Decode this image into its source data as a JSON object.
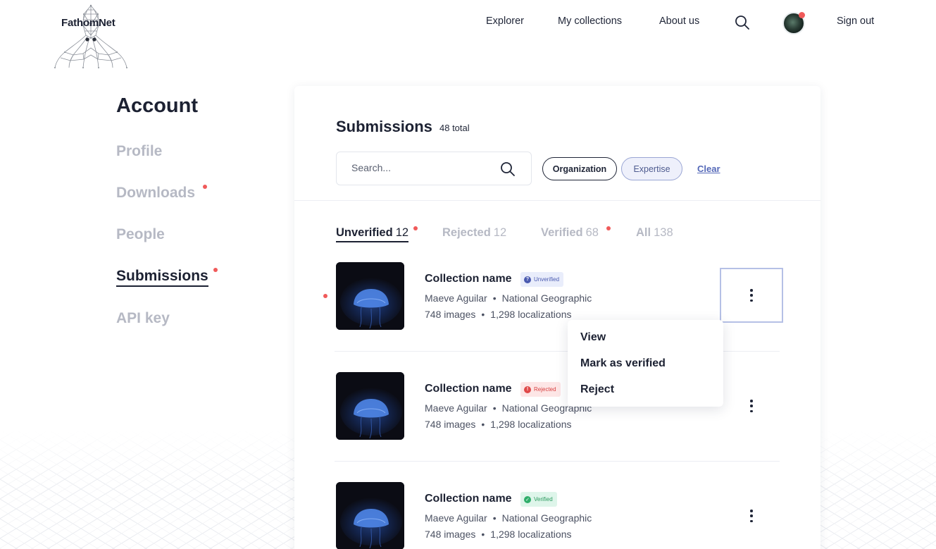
{
  "header": {
    "logo_text": "FathomNet",
    "nav": {
      "explorer": "Explorer",
      "my_collections": "My collections",
      "about": "About us",
      "sign_out": "Sign out"
    }
  },
  "sidebar": {
    "title": "Account",
    "items": [
      {
        "label": "Profile",
        "active": false,
        "has_dot": false
      },
      {
        "label": "Downloads",
        "active": false,
        "has_dot": true
      },
      {
        "label": "People",
        "active": false,
        "has_dot": false
      },
      {
        "label": "Submissions",
        "active": true,
        "has_dot": true
      },
      {
        "label": "API key",
        "active": false,
        "has_dot": false
      }
    ]
  },
  "main": {
    "title": "Submissions",
    "total": "48 total",
    "search": {
      "placeholder": "Search...",
      "value": ""
    },
    "filters": {
      "organization": "Organization",
      "expertise": "Expertise",
      "clear": "Clear"
    },
    "tabs": [
      {
        "label": "Unverified",
        "count": "12",
        "active": true,
        "has_dot": true
      },
      {
        "label": "Rejected",
        "count": "12",
        "active": false,
        "has_dot": false
      },
      {
        "label": "Verified",
        "count": "68",
        "active": false,
        "has_dot": true
      },
      {
        "label": "All",
        "count": "138",
        "active": false,
        "has_dot": false
      }
    ],
    "rows": [
      {
        "name": "Collection name",
        "status": "Unverified",
        "status_icon": "?",
        "author": "Maeve Aguilar",
        "org": "National Geographic",
        "images": "748 images",
        "localizations": "1,298 localizations",
        "separator": "•"
      },
      {
        "name": "Collection name",
        "status": "Rejected",
        "status_icon": "!",
        "author": "Maeve Aguilar",
        "org": "National Geographic",
        "images": "748 images",
        "localizations": "1,298 localizations",
        "separator": "•"
      },
      {
        "name": "Collection name",
        "status": "Verified",
        "status_icon": "✓",
        "author": "Maeve Aguilar",
        "org": "National Geographic",
        "images": "748 images",
        "localizations": "1,298 localizations",
        "separator": "•"
      }
    ],
    "menu": {
      "view": "View",
      "mark_verified": "Mark as verified",
      "reject": "Reject"
    }
  },
  "colors": {
    "accent": "#5468b8",
    "notification_dot": "#f05a5a",
    "unverified": "#4a5ab0",
    "rejected": "#d84040",
    "verified": "#2b9a5e"
  }
}
